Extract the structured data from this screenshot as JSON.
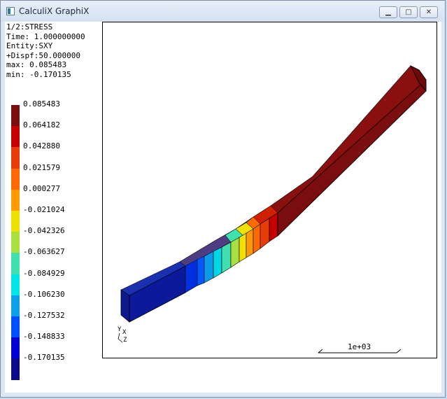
{
  "window": {
    "title": "CalculiX GraphiX"
  },
  "info_lines": [
    "1/2:STRESS",
    "Time: 1.000000000",
    "Entity:SXY",
    "+Dispf:50.000000",
    "max: 0.085483",
    "min: -0.170135"
  ],
  "legend": {
    "labels": [
      "0.085483",
      "0.064182",
      "0.042880",
      "0.021579",
      "0.000277",
      "-0.021024",
      "-0.042326",
      "-0.063627",
      "-0.084929",
      "-0.106230",
      "-0.127532",
      "-0.148833",
      "-0.170135"
    ],
    "colors": [
      "#7a0e0e",
      "#c40000",
      "#e83c0a",
      "#ff6a00",
      "#ff9a00",
      "#f0e000",
      "#a8e040",
      "#40e0b0",
      "#00e6e6",
      "#0ca0e8",
      "#0050ff",
      "#0000d0",
      "#0a0a8a"
    ]
  },
  "scale_bar": {
    "label": "1e+03"
  },
  "axes": {
    "x": "X",
    "y": "Y",
    "z": "Z"
  }
}
